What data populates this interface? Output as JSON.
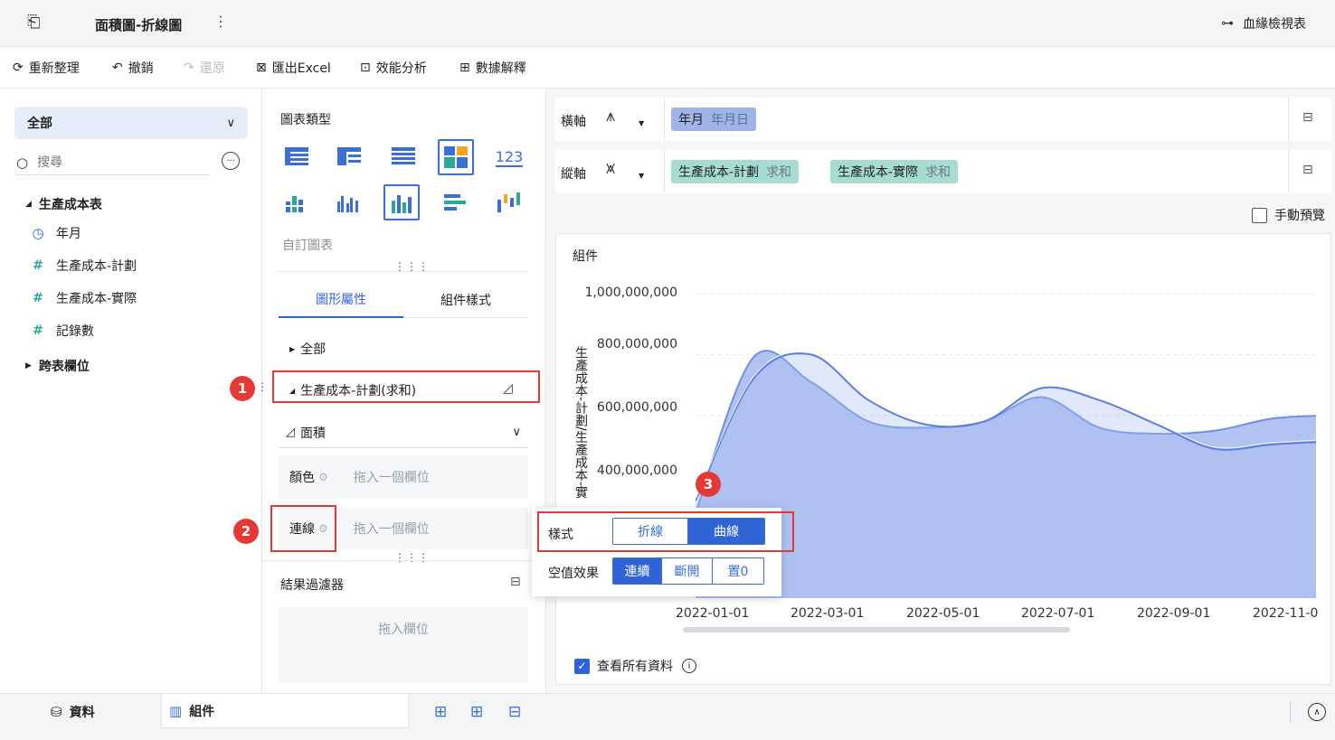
{
  "header": {
    "title": "面積圖-折線圖",
    "lineage_label": "血緣檢視表"
  },
  "toolbar": {
    "refresh": "重新整理",
    "undo": "撤銷",
    "redo": "還原",
    "export": "匯出Excel",
    "perf": "效能分析",
    "explain": "數據解釋"
  },
  "left": {
    "category_select": "全部",
    "search_placeholder": "搜尋",
    "table_name": "生產成本表",
    "fields": [
      "年月",
      "生產成本-計劃",
      "生產成本-實際",
      "記錄數"
    ],
    "cross_table": "跨表欄位"
  },
  "mid": {
    "chart_type_label": "圖表類型",
    "custom_chart": "自訂圖表",
    "tabs": [
      "圖形屬性",
      "組件樣式"
    ],
    "all_label": "全部",
    "series_label": "生產成本-計劃(求和)",
    "mark_type": "面積",
    "color_label": "顏色",
    "line_label": "連線",
    "drop_field": "拖入一個欄位",
    "result_filter": "結果過濾器",
    "drop_simple": "拖入欄位"
  },
  "axes": {
    "x_label": "橫軸",
    "y_label": "縱軸",
    "x_field": {
      "name": "年月",
      "sub": "年月日"
    },
    "y_fields": [
      {
        "name": "生產成本-計劃",
        "sub": "求和"
      },
      {
        "name": "生產成本-實際",
        "sub": "求和"
      }
    ],
    "manual_preview": "手動預覽"
  },
  "popup": {
    "style_label": "樣式",
    "style_options": [
      "折線",
      "曲線"
    ],
    "null_label": "空值效果",
    "null_options": [
      "連續",
      "斷開",
      "置0"
    ]
  },
  "badges": [
    "1",
    "2",
    "3"
  ],
  "chart_panel": {
    "title": "組件",
    "view_all": "查看所有資料"
  },
  "chart_data": {
    "type": "area",
    "title": "",
    "ylabel": "生產成本-計劃/生產成本-實際",
    "y_ticks": [
      "400,000,000",
      "600,000,000",
      "800,000,000",
      "1,000,000,000"
    ],
    "x_ticks": [
      "2022-01-01",
      "2022-03-01",
      "2022-05-01",
      "2022-07-01",
      "2022-09-01",
      "2022-11-0"
    ],
    "ylim": [
      0,
      1000000000
    ],
    "x": [
      "2022-01-01",
      "2022-02-01",
      "2022-03-01",
      "2022-04-01",
      "2022-05-01",
      "2022-06-01",
      "2022-07-01",
      "2022-08-01",
      "2022-09-01",
      "2022-10-01",
      "2022-11-01",
      "2022-12-01"
    ],
    "series": [
      {
        "values": [
          280000000,
          790000000,
          710000000,
          580000000,
          560000000,
          580000000,
          660000000,
          560000000,
          540000000,
          550000000,
          590000000,
          600000000
        ]
      },
      {
        "values": [
          320000000,
          720000000,
          800000000,
          650000000,
          570000000,
          580000000,
          690000000,
          650000000,
          570000000,
          490000000,
          505000000,
          515000000
        ]
      }
    ],
    "colors": {
      "area": "#a8bdf0",
      "line": "#6f8fe6",
      "line2": "#5b7fe0"
    }
  },
  "bottom": {
    "data_tab": "資料",
    "component_tab": "組件"
  }
}
